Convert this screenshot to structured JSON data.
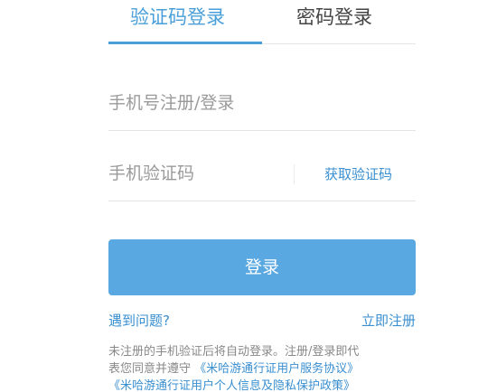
{
  "tabs": {
    "sms_login": "验证码登录",
    "password_login": "密码登录"
  },
  "form": {
    "phone_placeholder": "手机号注册/登录",
    "code_placeholder": "手机验证码",
    "get_code": "获取验证码",
    "login_button": "登录"
  },
  "links": {
    "help": "遇到问题?",
    "register": "立即注册"
  },
  "terms": {
    "line1": "未注册的手机验证后将自动登录。注册/登录即代",
    "line2_prefix": "表您同意并遵守 ",
    "service_agreement": "《米哈游通行证用户服务协议》",
    "privacy_policy": "《米哈游通行证用户个人信息及隐私保护政策》"
  },
  "colors": {
    "accent": "#4a9fd9",
    "button": "#5aa8e2",
    "link": "#3a8fd0",
    "placeholder": "#9a9a9a"
  }
}
